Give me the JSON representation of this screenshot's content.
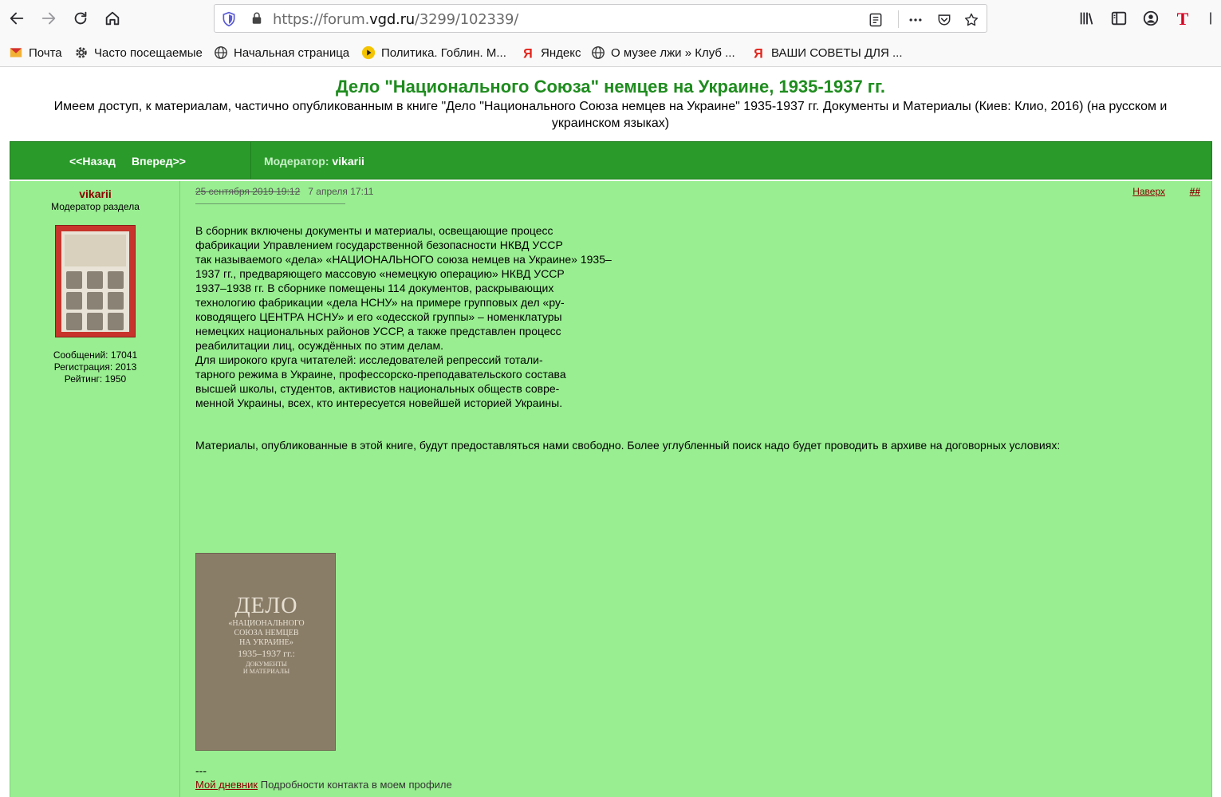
{
  "browser": {
    "url_prefix": "https://forum.",
    "url_domain": "vgd.ru",
    "url_path": "/3299/102339/"
  },
  "bookmarks": [
    {
      "label": "Почта",
      "icon": "mail-icon"
    },
    {
      "label": "Часто посещаемые",
      "icon": "gear-icon"
    },
    {
      "label": "Начальная страница",
      "icon": "globe-icon"
    },
    {
      "label": "Политика. Гоблин. М...",
      "icon": "play-icon"
    },
    {
      "label": "Яндекс",
      "icon": "yandex-icon"
    },
    {
      "label": "О музее лжи » Клуб ...",
      "icon": "globe-icon"
    },
    {
      "label": "ВАШИ СОВЕТЫ ДЛЯ ...",
      "icon": "yandex-icon"
    }
  ],
  "forum": {
    "title": "Дело \"Национального Союза\" немцев на Украине, 1935-1937 гг.",
    "description": "Имеем доступ, к материалам, частично опубликованным в книге \"Дело \"Национального Союза немцев на Украине\" 1935-1937 гг. Документы и Материалы (Киев: Клио, 2016) (на русском и украинском языках)",
    "nav_back": "<<Назад",
    "nav_forward": "Вперед>>",
    "moderator_label": "Модератор:",
    "moderator_name": "vikarii"
  },
  "post": {
    "author": "vikarii",
    "role": "Модератор раздела",
    "messages": "Сообщений: 17041",
    "registration": "Регистрация: 2013",
    "rating": "Рейтинг: 1950",
    "date_old": "25 сентября 2019 19:12",
    "date_new": "7 апреля 17:11",
    "top_link": "Наверх",
    "anchor_link": "##",
    "lines": [
      "В сборник включены документы и материалы, освещающие процесс",
      "фабрикации Управлением государственной безопасности НКВД УССР",
      "так называемого «дела» «НАЦИОНАЛЬНОГО союза немцев на Украине» 1935–",
      "1937 гг., предваряющего массовую «немецкую операцию» НКВД УССР",
      "1937–1938 гг. В сборнике помещены 114 документов, раскрывающих",
      "технологию фабрикации «дела НСНУ» на примере групповых дел «ру-",
      "ководящего ЦЕНТРА НСНУ» и его «одесской группы» – номенклатуры",
      "немецких национальных районов УССР, а также представлен процесс",
      "реабилитации лиц, осуждённых по этим делам.",
      "Для широкого круга читателей: исследователей репрессий тотали-",
      "тарного режима в Украине, профессорско-преподавательского состава",
      "высшей школы, студентов, активистов национальных обществ совре-",
      "менной Украины, всех, кто интересуется новейшей историей Украины."
    ],
    "paragraph2": "Материалы, опубликованные в этой книге, будут предоставляться нами свободно. Более углубленный поиск надо будет проводить в архиве на договорных условиях:",
    "book_cover": {
      "line1": "ДЕЛО",
      "line2": "«НАЦИОНАЛЬНОГО",
      "line3": "СОЮЗА НЕМЦЕВ",
      "line4": "НА УКРАИНЕ»",
      "line5": "1935–1937 гг.:",
      "line6": "ДОКУМЕНТЫ",
      "line7": "И МАТЕРИАЛЫ"
    },
    "sig_separator": "---",
    "sig_diary": "Мой дневник",
    "sig_contact": "Подробности контакта в моем профиле"
  }
}
